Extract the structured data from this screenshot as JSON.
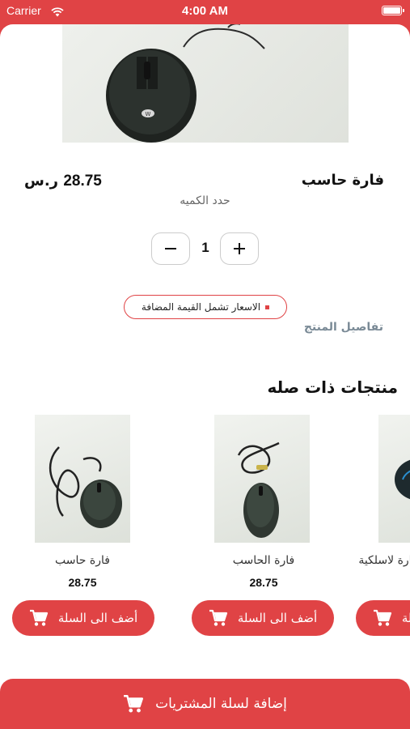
{
  "status_bar": {
    "carrier": "Carrier",
    "time": "4:00 AM"
  },
  "product": {
    "name": "فارة حاسب",
    "price": "28.75",
    "currency": "ر.س",
    "quantity_label": "حدد الكميه",
    "quantity": "1",
    "vat_note": "الاسعار تشمل القيمة المضافة",
    "details_link": "تفاصيل المنتج"
  },
  "related": {
    "title": "منتجات ذات صله",
    "items": [
      {
        "name": "فارة حاسب",
        "price": "28.75",
        "button": "أضف الى السلة"
      },
      {
        "name": "فارة الحاسب",
        "price": "28.75",
        "button": "أضف الى السلة"
      },
      {
        "name": "فارة لاسلكية",
        "price": "",
        "button": "أضف الى السلة"
      }
    ]
  },
  "bottom_bar": {
    "label": "إضافة لسلة المشتريات"
  },
  "colors": {
    "accent": "#e04345",
    "muted": "#7a8a96"
  }
}
